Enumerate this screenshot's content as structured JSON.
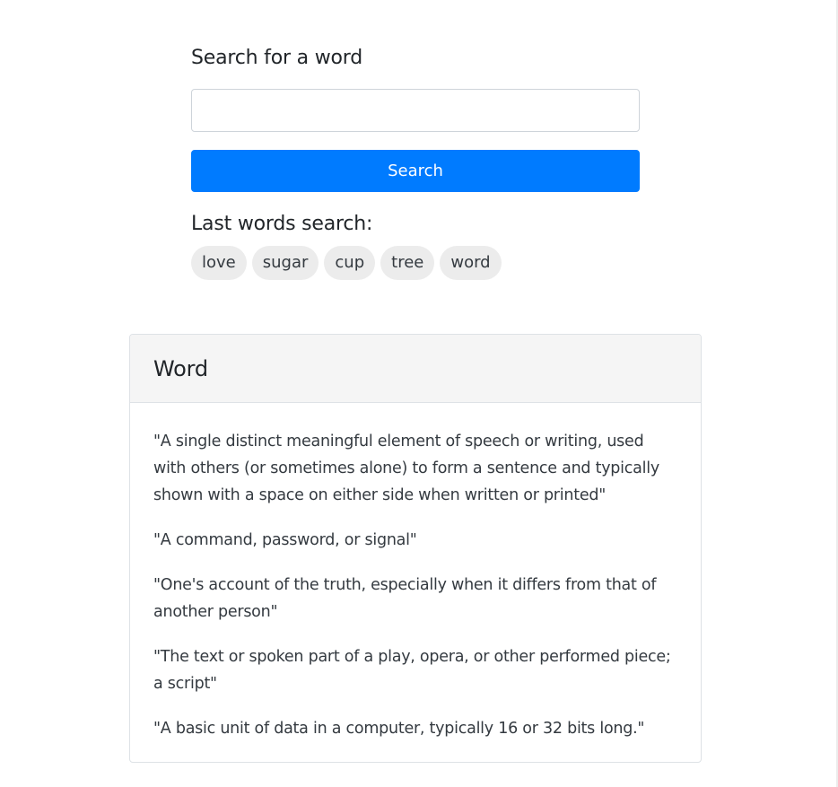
{
  "search": {
    "heading": "Search for a word",
    "input_value": "",
    "button_label": "Search"
  },
  "history": {
    "heading": "Last words search:",
    "words": [
      "love",
      "sugar",
      "cup",
      "tree",
      "word"
    ]
  },
  "result": {
    "title": "Word",
    "definitions": [
      "\"A single distinct meaningful element of speech or writing, used with others (or sometimes alone) to form a sentence and typically shown with a space on either side when written or printed\"",
      "\"A command, password, or signal\"",
      "\"One's account of the truth, especially when it differs from that of another person\"",
      "\"The text or spoken part of a play, opera, or other performed piece; a script\"",
      "\"A basic unit of data in a computer, typically 16 or 32 bits long.\""
    ]
  },
  "colors": {
    "primary": "#007bff",
    "tag_background": "#ececec",
    "card_header_background": "#f5f5f5"
  }
}
